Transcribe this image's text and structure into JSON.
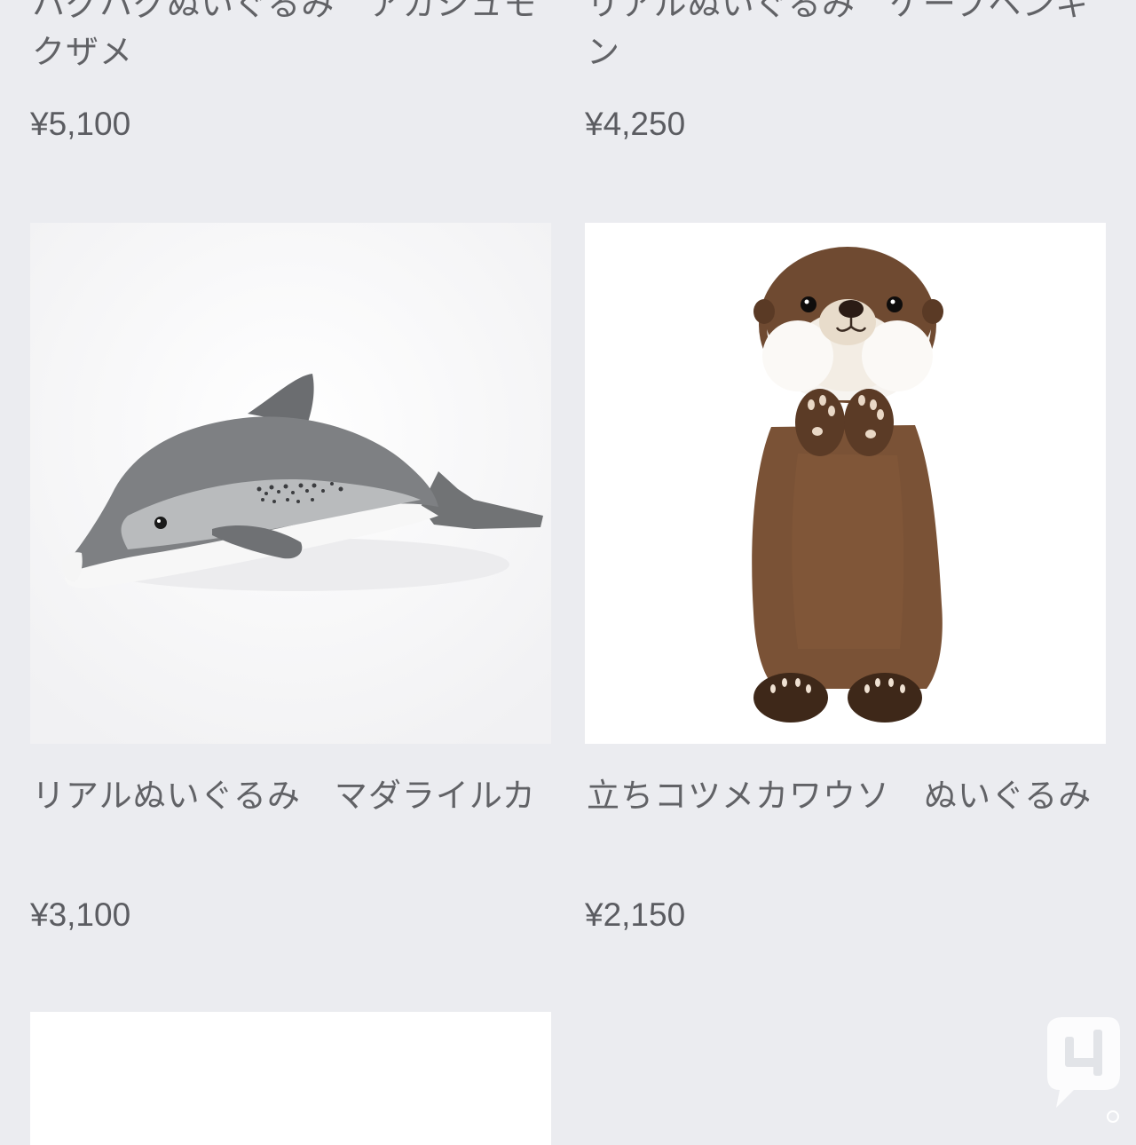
{
  "products": [
    {
      "title": "ハグハグぬいぐるみ　アカシュモクザメ",
      "price": "¥5,100"
    },
    {
      "title": "リアルぬいぐるみ　ケープペンギン",
      "price": "¥4,250"
    },
    {
      "title": "リアルぬいぐるみ　マダライルカ",
      "price": "¥3,100",
      "image": "dolphin-plush"
    },
    {
      "title": "立ちコツメカワウソ　ぬいぐるみ",
      "price": "¥2,150",
      "image": "otter-plush"
    }
  ],
  "colors": {
    "background": "#ebecf0",
    "card_image_bg": "#ffffff",
    "text": "#616266"
  }
}
